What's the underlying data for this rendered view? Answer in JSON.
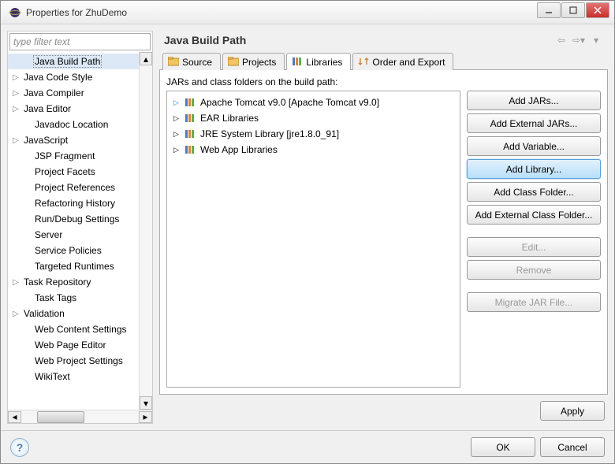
{
  "window": {
    "title": "Properties for ZhuDemo"
  },
  "filter": {
    "placeholder": "type filter text"
  },
  "tree": {
    "items": [
      {
        "label": "Java Build Path",
        "exp": "",
        "sel": true,
        "indent": 1
      },
      {
        "label": "Java Code Style",
        "exp": "▷",
        "indent": 0
      },
      {
        "label": "Java Compiler",
        "exp": "▷",
        "indent": 0
      },
      {
        "label": "Java Editor",
        "exp": "▷",
        "indent": 0
      },
      {
        "label": "Javadoc Location",
        "exp": "",
        "indent": 1
      },
      {
        "label": "JavaScript",
        "exp": "▷",
        "indent": 0
      },
      {
        "label": "JSP Fragment",
        "exp": "",
        "indent": 1
      },
      {
        "label": "Project Facets",
        "exp": "",
        "indent": 1
      },
      {
        "label": "Project References",
        "exp": "",
        "indent": 1
      },
      {
        "label": "Refactoring History",
        "exp": "",
        "indent": 1
      },
      {
        "label": "Run/Debug Settings",
        "exp": "",
        "indent": 1
      },
      {
        "label": "Server",
        "exp": "",
        "indent": 1
      },
      {
        "label": "Service Policies",
        "exp": "",
        "indent": 1
      },
      {
        "label": "Targeted Runtimes",
        "exp": "",
        "indent": 1
      },
      {
        "label": "Task Repository",
        "exp": "▷",
        "indent": 0
      },
      {
        "label": "Task Tags",
        "exp": "",
        "indent": 1
      },
      {
        "label": "Validation",
        "exp": "▷",
        "indent": 0
      },
      {
        "label": "Web Content Settings",
        "exp": "",
        "indent": 1
      },
      {
        "label": "Web Page Editor",
        "exp": "",
        "indent": 1
      },
      {
        "label": "Web Project Settings",
        "exp": "",
        "indent": 1
      },
      {
        "label": "WikiText",
        "exp": "",
        "indent": 1
      }
    ]
  },
  "page": {
    "title": "Java Build Path",
    "desc": "JARs and class folders on the build path:"
  },
  "tabs": [
    {
      "label": "Source"
    },
    {
      "label": "Projects"
    },
    {
      "label": "Libraries"
    },
    {
      "label": "Order and Export"
    }
  ],
  "libs": [
    {
      "exp": "▷",
      "open": true,
      "label": "Apache Tomcat v9.0 [Apache Tomcat v9.0]"
    },
    {
      "exp": "▷",
      "open": false,
      "label": "EAR Libraries"
    },
    {
      "exp": "▷",
      "open": false,
      "label": "JRE System Library [jre1.8.0_91]"
    },
    {
      "exp": "▷",
      "open": false,
      "label": "Web App Libraries"
    }
  ],
  "buttons": {
    "addJars": "Add JARs...",
    "addExtJars": "Add External JARs...",
    "addVar": "Add Variable...",
    "addLib": "Add Library...",
    "addClassFolder": "Add Class Folder...",
    "addExtClassFolder": "Add External Class Folder...",
    "edit": "Edit...",
    "remove": "Remove",
    "migrate": "Migrate JAR File...",
    "apply": "Apply",
    "ok": "OK",
    "cancel": "Cancel"
  }
}
